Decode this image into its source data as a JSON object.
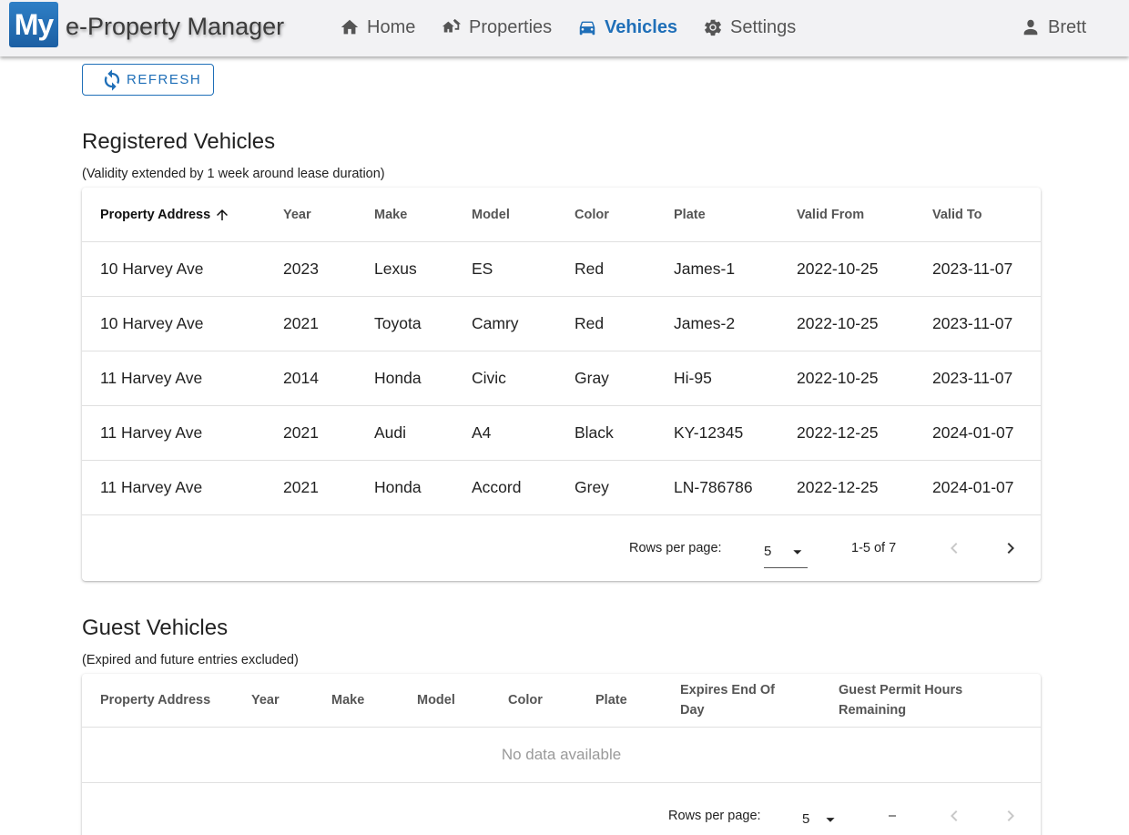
{
  "appbar": {
    "logo_text": "My",
    "app_name": "e-Property Manager",
    "nav": [
      {
        "label": "Home",
        "icon": "home-icon"
      },
      {
        "label": "Properties",
        "icon": "properties-icon"
      },
      {
        "label": "Vehicles",
        "icon": "car-icon",
        "active": true
      },
      {
        "label": "Settings",
        "icon": "gear-icon"
      }
    ],
    "user": {
      "label": "Brett",
      "icon": "user-icon"
    },
    "accent_color": "#1f6fb8"
  },
  "refresh_label": "REFRESH",
  "registered": {
    "title": "Registered Vehicles",
    "subtitle": "(Validity extended by 1 week around lease duration)",
    "headers": [
      "Property Address",
      "Year",
      "Make",
      "Model",
      "Color",
      "Plate",
      "Valid From",
      "Valid To"
    ],
    "sorted_column": "Property Address",
    "rows": [
      [
        "10 Harvey Ave",
        "2023",
        "Lexus",
        "ES",
        "Red",
        "James-1",
        "2022-10-25",
        "2023-11-07"
      ],
      [
        "10 Harvey Ave",
        "2021",
        "Toyota",
        "Camry",
        "Red",
        "James-2",
        "2022-10-25",
        "2023-11-07"
      ],
      [
        "11 Harvey Ave",
        "2014",
        "Honda",
        "Civic",
        "Gray",
        "Hi-95",
        "2022-10-25",
        "2023-11-07"
      ],
      [
        "11 Harvey Ave",
        "2021",
        "Audi",
        "A4",
        "Black",
        "KY-12345",
        "2022-12-25",
        "2024-01-07"
      ],
      [
        "11 Harvey Ave",
        "2021",
        "Honda",
        "Accord",
        "Grey",
        "LN-786786",
        "2022-12-25",
        "2024-01-07"
      ]
    ],
    "footer": {
      "rows_per_page_label": "Rows per page:",
      "rows_per_page_value": "5",
      "range_text": "1-5 of 7"
    }
  },
  "guest": {
    "title": "Guest Vehicles",
    "subtitle": "(Expired and future entries excluded)",
    "headers": [
      "Property Address",
      "Year",
      "Make",
      "Model",
      "Color",
      "Plate",
      "Expires End Of Day",
      "Guest Permit Hours Remaining"
    ],
    "empty_text": "No data available",
    "footer": {
      "rows_per_page_label": "Rows per page:",
      "rows_per_page_value": "5",
      "range_text": "–"
    }
  }
}
